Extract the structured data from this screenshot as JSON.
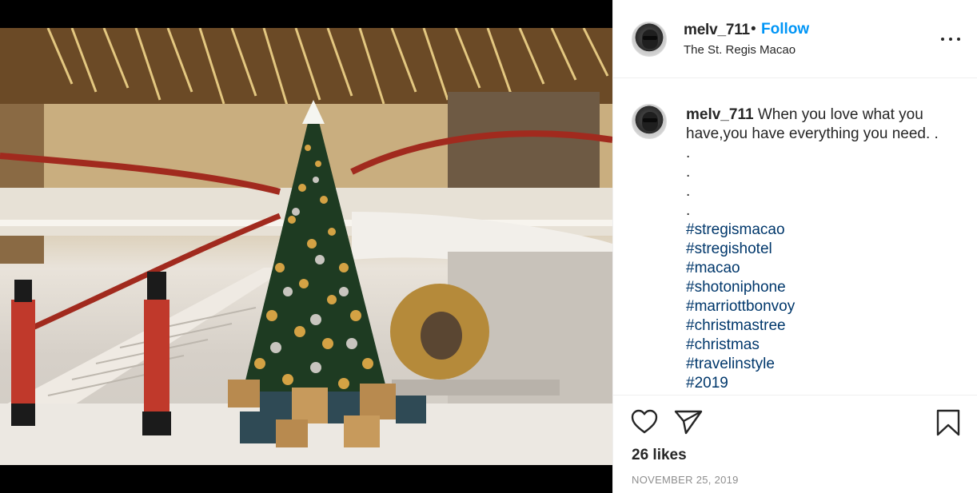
{
  "post": {
    "username": "melv_711",
    "separator": "•",
    "follow_label": "Follow",
    "location": "The St. Regis Macao"
  },
  "caption": {
    "username": "melv_711",
    "text": "When you love what you have,you have everything you need. .",
    "dot_lines": [
      ".",
      ".",
      ".",
      "."
    ],
    "hashtags": [
      "#stregismacao",
      "#stregishotel",
      "#macao",
      "#shotoniphone",
      "#marriottbonvoy",
      "#christmastree",
      "#christmas",
      "#travelinstyle",
      "#2019"
    ]
  },
  "footer": {
    "likes": "26 likes",
    "date": "NOVEMBER 25, 2019"
  },
  "icons": {
    "like": "heart-icon",
    "share": "paper-plane-icon",
    "save": "bookmark-icon",
    "more": "more-options-icon"
  },
  "colors": {
    "follow": "#0095f6",
    "hashtag": "#00376b",
    "text": "#262626",
    "muted": "#8e8e8e"
  }
}
